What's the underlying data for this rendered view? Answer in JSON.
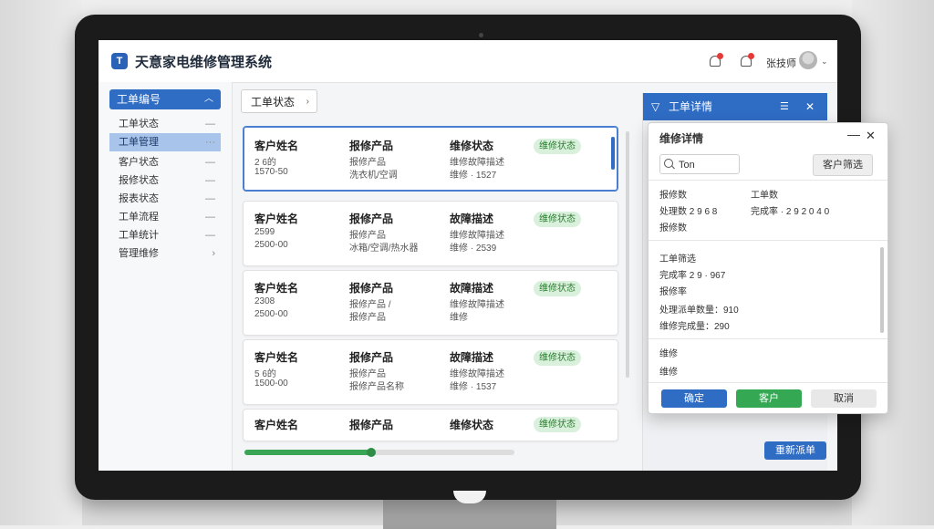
{
  "app": {
    "title": "天意家电维修管理系统"
  },
  "header": {
    "user_name": "张技师"
  },
  "sidebar": {
    "head": "工单编号",
    "items": [
      {
        "label": "工单状态"
      },
      {
        "label": "工单管理"
      },
      {
        "label": "客户状态"
      },
      {
        "label": "报修状态"
      },
      {
        "label": "报表状态"
      },
      {
        "label": "工单流程"
      },
      {
        "label": "工单统计"
      },
      {
        "label": "管理维修"
      }
    ]
  },
  "main": {
    "filter_label": "工单状态",
    "cards": [
      {
        "c1_title": "客户姓名",
        "c1_l1": "2 6的",
        "c1_l2": "1570-50",
        "c2_title": "报修产品",
        "c2_l1": "报修产品",
        "c2_l2": "洗衣机/空调",
        "c3_title": "维修状态",
        "c3_l1": "维修故障描述",
        "c3_l2": "维修 · 1527",
        "badge": "维修状态"
      },
      {
        "c1_title": "客户姓名",
        "c1_l1": "2599",
        "c1_l2": "2500-00",
        "c2_title": "报修产品",
        "c2_l1": "报修产品",
        "c2_l2": "冰箱/空调/热水器",
        "c3_title": "故障描述",
        "c3_l1": "维修故障描述",
        "c3_l2": "维修 · 2539",
        "badge": "维修状态"
      },
      {
        "c1_title": "客户姓名",
        "c1_l1": "2308",
        "c1_l2": "2500-00",
        "c2_title": "报修产品",
        "c2_l1": "报修产品 /",
        "c2_l2": "报修产品",
        "c3_title": "故障描述",
        "c3_l1": "维修故障描述",
        "c3_l2": "维修",
        "badge": "维修状态"
      },
      {
        "c1_title": "客户姓名",
        "c1_l1": "5 6的",
        "c1_l2": "1500-00",
        "c2_title": "报修产品",
        "c2_l1": "报修产品",
        "c2_l2": "报修产品名称",
        "c3_title": "故障描述",
        "c3_l1": "维修故障描述",
        "c3_l2": "维修 · 1537",
        "badge": "维修状态"
      },
      {
        "c1_title": "客户姓名",
        "c1_l1": "",
        "c1_l2": "",
        "c2_title": "报修产品",
        "c2_l1": "",
        "c2_l2": "",
        "c3_title": "维修状态",
        "c3_l1": "",
        "c3_l2": "",
        "badge": "维修状态"
      }
    ],
    "progress": 0.47
  },
  "rpanel": {
    "title": "工单详情",
    "button": "重新派单"
  },
  "dialog": {
    "title": "维修详情",
    "search_value": "Ton",
    "filter_btn": "客户筛选",
    "col1_label": "报修数",
    "col1_value": "处理数 2 9 6 8",
    "col1_extra": "报修数",
    "col2_label": "工单数",
    "col2_value": "完成率 · 2 9 2 0 4 0",
    "section_title": "工单筛选",
    "sec_l1": "完成率 2 9 · 967",
    "sec_l2": "报修率",
    "sec_l3": "处理派单数量：910",
    "sec_l4": "维修完成量：290",
    "bottom_l1": "维修",
    "bottom_l2": "维修",
    "btn_confirm": "确定",
    "btn_customer": "客户",
    "btn_cancel": "取消"
  },
  "colors": {
    "primary": "#2f6cc4",
    "success": "#3aa655",
    "badge_bg": "#d9f0dc"
  }
}
